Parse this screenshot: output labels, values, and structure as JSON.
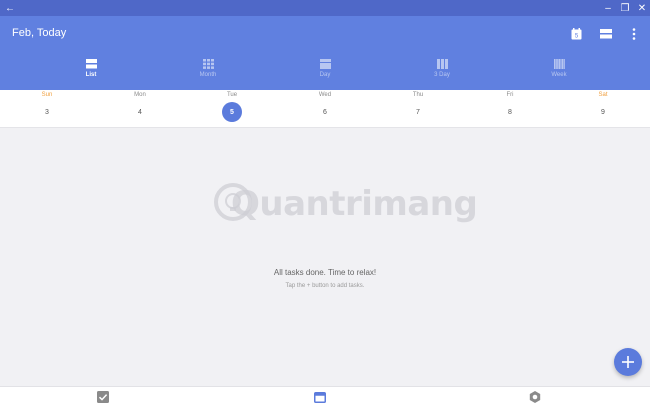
{
  "window": {
    "back_icon": "arrow-left-icon",
    "controls": [
      "minimize-icon",
      "restore-icon",
      "close-icon"
    ],
    "glyphs": {
      "back": "←",
      "minimize": "–",
      "restore": "❐",
      "close": "✕"
    }
  },
  "header": {
    "title": "Feb, Today",
    "actions": [
      "calendar-today-icon",
      "view-toggle-icon",
      "more-vert-icon"
    ],
    "today_badge": "5"
  },
  "tabs": [
    {
      "label": "List",
      "icon": "list-view-icon",
      "active": true
    },
    {
      "label": "Month",
      "icon": "month-view-icon",
      "active": false
    },
    {
      "label": "Day",
      "icon": "day-view-icon",
      "active": false
    },
    {
      "label": "3 Day",
      "icon": "three-day-view-icon",
      "active": false
    },
    {
      "label": "Week",
      "icon": "week-view-icon",
      "active": false
    }
  ],
  "week": [
    {
      "name": "Sun",
      "num": "3",
      "weekend": true
    },
    {
      "name": "Mon",
      "num": "4"
    },
    {
      "name": "Tue",
      "num": "5",
      "today": true
    },
    {
      "name": "Wed",
      "num": "6"
    },
    {
      "name": "Thu",
      "num": "7"
    },
    {
      "name": "Fri",
      "num": "8"
    },
    {
      "name": "Sat",
      "num": "9",
      "weekend": true
    }
  ],
  "watermark": {
    "text": "Quantrimang"
  },
  "empty_state": {
    "title": "All tasks done. Time to relax!",
    "subtitle": "Tap the + button to add tasks."
  },
  "fab": {
    "label": "+",
    "icon": "add-icon"
  },
  "bottom_nav": [
    "tasks-checkbox-icon",
    "calendar-icon",
    "settings-gear-icon"
  ],
  "colors": {
    "primary": "#6080e0",
    "titlebar": "#4f68c8",
    "accent": "#5b7bdc",
    "weekend": "#f0a040",
    "background": "#f1f1f4"
  }
}
